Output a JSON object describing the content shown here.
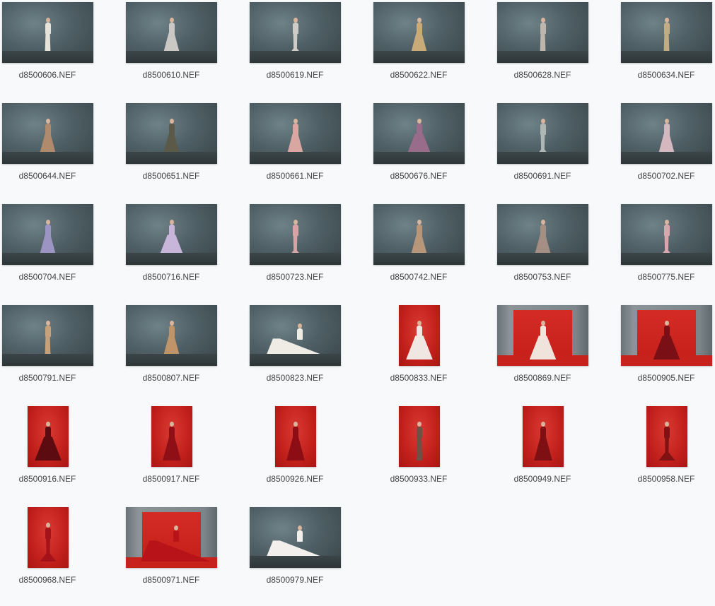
{
  "files": [
    {
      "name": "d8500606.NEF",
      "orientation": "landscape",
      "scene": "slate",
      "dress_color": "#e6e3da",
      "silhouette": "slim"
    },
    {
      "name": "d8500610.NEF",
      "orientation": "landscape",
      "scene": "slate",
      "dress_color": "#c9c8c4",
      "silhouette": "aline"
    },
    {
      "name": "d8500619.NEF",
      "orientation": "landscape",
      "scene": "slate",
      "dress_color": "#cfcbc6",
      "silhouette": "mermaid"
    },
    {
      "name": "d8500622.NEF",
      "orientation": "landscape",
      "scene": "slate",
      "dress_color": "#c8ab78",
      "silhouette": "aline"
    },
    {
      "name": "d8500628.NEF",
      "orientation": "landscape",
      "scene": "slate",
      "dress_color": "#bdb6ad",
      "silhouette": "slim"
    },
    {
      "name": "d8500634.NEF",
      "orientation": "landscape",
      "scene": "slate",
      "dress_color": "#c2ad82",
      "silhouette": "slim"
    },
    {
      "name": "d8500644.NEF",
      "orientation": "landscape",
      "scene": "slate",
      "dress_color": "#b08a6c",
      "silhouette": "aline"
    },
    {
      "name": "d8500651.NEF",
      "orientation": "landscape",
      "scene": "slate",
      "dress_color": "#5b5a48",
      "silhouette": "aline"
    },
    {
      "name": "d8500661.NEF",
      "orientation": "landscape",
      "scene": "slate",
      "dress_color": "#d9a7a2",
      "silhouette": "aline"
    },
    {
      "name": "d8500676.NEF",
      "orientation": "landscape",
      "scene": "slate",
      "dress_color": "#9a6c8c",
      "silhouette": "ball"
    },
    {
      "name": "d8500691.NEF",
      "orientation": "landscape",
      "scene": "slate",
      "dress_color": "#aeb7b4",
      "silhouette": "mermaid"
    },
    {
      "name": "d8500702.NEF",
      "orientation": "landscape",
      "scene": "slate",
      "dress_color": "#d5b8bf",
      "silhouette": "aline"
    },
    {
      "name": "d8500704.NEF",
      "orientation": "landscape",
      "scene": "slate",
      "dress_color": "#9c94c2",
      "silhouette": "aline"
    },
    {
      "name": "d8500716.NEF",
      "orientation": "landscape",
      "scene": "slate",
      "dress_color": "#c8b6da",
      "silhouette": "ball"
    },
    {
      "name": "d8500723.NEF",
      "orientation": "landscape",
      "scene": "slate",
      "dress_color": "#d8a3a4",
      "silhouette": "mermaid"
    },
    {
      "name": "d8500742.NEF",
      "orientation": "landscape",
      "scene": "slate",
      "dress_color": "#b8967a",
      "silhouette": "aline"
    },
    {
      "name": "d8500753.NEF",
      "orientation": "landscape",
      "scene": "slate",
      "dress_color": "#a58f84",
      "silhouette": "aline"
    },
    {
      "name": "d8500775.NEF",
      "orientation": "landscape",
      "scene": "slate",
      "dress_color": "#d8a6ad",
      "silhouette": "mermaid"
    },
    {
      "name": "d8500791.NEF",
      "orientation": "landscape",
      "scene": "slate",
      "dress_color": "#c6a27c",
      "silhouette": "slim"
    },
    {
      "name": "d8500807.NEF",
      "orientation": "landscape",
      "scene": "slate",
      "dress_color": "#bf9468",
      "silhouette": "aline"
    },
    {
      "name": "d8500823.NEF",
      "orientation": "landscape",
      "scene": "slate",
      "dress_color": "#efece6",
      "silhouette": "train"
    },
    {
      "name": "d8500833.NEF",
      "orientation": "portrait",
      "scene": "red",
      "dress_color": "#f1e7e2",
      "silhouette": "ball"
    },
    {
      "name": "d8500869.NEF",
      "orientation": "landscape",
      "scene": "studio",
      "dress_color": "#f0e3dc",
      "silhouette": "ball"
    },
    {
      "name": "d8500905.NEF",
      "orientation": "landscape",
      "scene": "studio",
      "dress_color": "#7a0f15",
      "silhouette": "ball"
    },
    {
      "name": "d8500916.NEF",
      "orientation": "portrait",
      "scene": "red",
      "dress_color": "#5c0b10",
      "silhouette": "ball"
    },
    {
      "name": "d8500917.NEF",
      "orientation": "portrait",
      "scene": "red",
      "dress_color": "#8e1016",
      "silhouette": "aline"
    },
    {
      "name": "d8500926.NEF",
      "orientation": "portrait",
      "scene": "red",
      "dress_color": "#8c0e14",
      "silhouette": "aline"
    },
    {
      "name": "d8500933.NEF",
      "orientation": "portrait",
      "scene": "red",
      "dress_color": "#6e5046",
      "silhouette": "slim"
    },
    {
      "name": "d8500949.NEF",
      "orientation": "portrait",
      "scene": "red",
      "dress_color": "#7e1014",
      "silhouette": "aline"
    },
    {
      "name": "d8500958.NEF",
      "orientation": "portrait",
      "scene": "red",
      "dress_color": "#801214",
      "silhouette": "mermaid"
    },
    {
      "name": "d8500968.NEF",
      "orientation": "portrait",
      "scene": "red",
      "dress_color": "#a5131a",
      "silhouette": "mermaid"
    },
    {
      "name": "d8500971.NEF",
      "orientation": "landscape",
      "scene": "studio",
      "dress_color": "#b81318",
      "silhouette": "train"
    },
    {
      "name": "d8500979.NEF",
      "orientation": "landscape",
      "scene": "slate",
      "dress_color": "#f2efec",
      "silhouette": "train"
    }
  ]
}
